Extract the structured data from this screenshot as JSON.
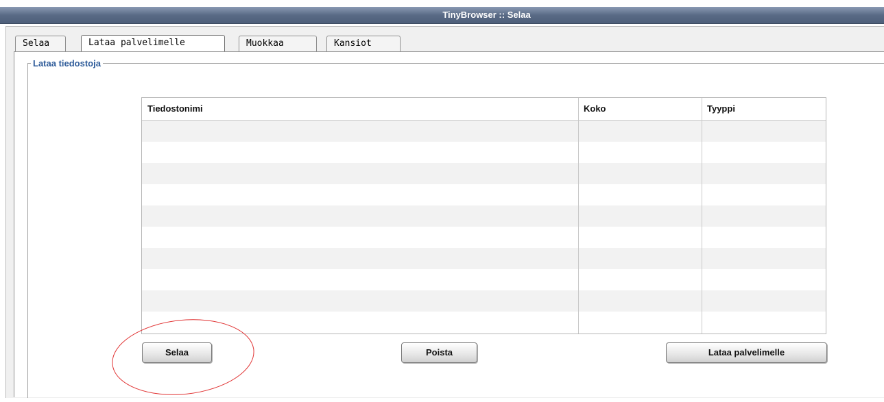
{
  "window": {
    "title": "TinyBrowser :: Selaa"
  },
  "tabs": [
    {
      "label": "Selaa"
    },
    {
      "label": "Lataa palvelimelle",
      "active": true
    },
    {
      "label": "Muokkaa"
    },
    {
      "label": "Kansiot"
    }
  ],
  "upload": {
    "legend": "Lataa tiedostoja",
    "columns": [
      "Tiedostonimi",
      "Koko",
      "Tyyppi"
    ],
    "rows": [],
    "buttons": {
      "browse": "Selaa",
      "remove": "Poista",
      "upload": "Lataa palvelimelle"
    }
  },
  "colors": {
    "annotation_circle": "#e03030",
    "legend": "#2f5c9a"
  }
}
